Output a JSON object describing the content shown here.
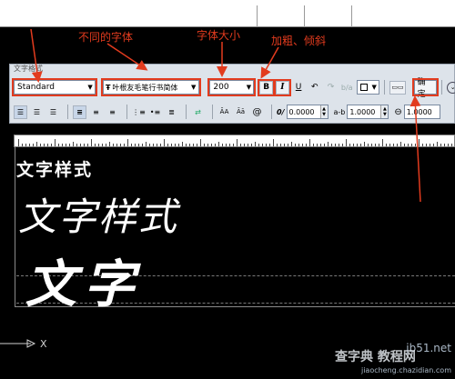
{
  "annotations": {
    "font": "不同的字体",
    "size": "字体大小",
    "style": "加粗、倾斜"
  },
  "toolbar": {
    "title": "文字格式",
    "style_select": "Standard",
    "font_select": "叶根友毛笔行书简体",
    "font_type_icon": "truetype-icon",
    "size_select": "200",
    "bold": "B",
    "italic": "I",
    "underline": "U",
    "ok_label": "确定",
    "oblique_value": "0.0000",
    "tracking_value": "1.0000",
    "width_value": "1.0000",
    "tracking_prefix": "a-b",
    "oblique_prefix": "0/",
    "uppercase": "ĀA",
    "lowercase": "Āā",
    "insert_field": "@",
    "accent": "#dde3ea"
  },
  "canvas": {
    "line1": "文字样式",
    "line2": "文字样式",
    "line3": "文字"
  },
  "axis": {
    "label": "X"
  },
  "watermark": {
    "brand": "jb51.net",
    "cn": "查字典 教程网",
    "url": "jiaocheng.chazidian.com"
  }
}
